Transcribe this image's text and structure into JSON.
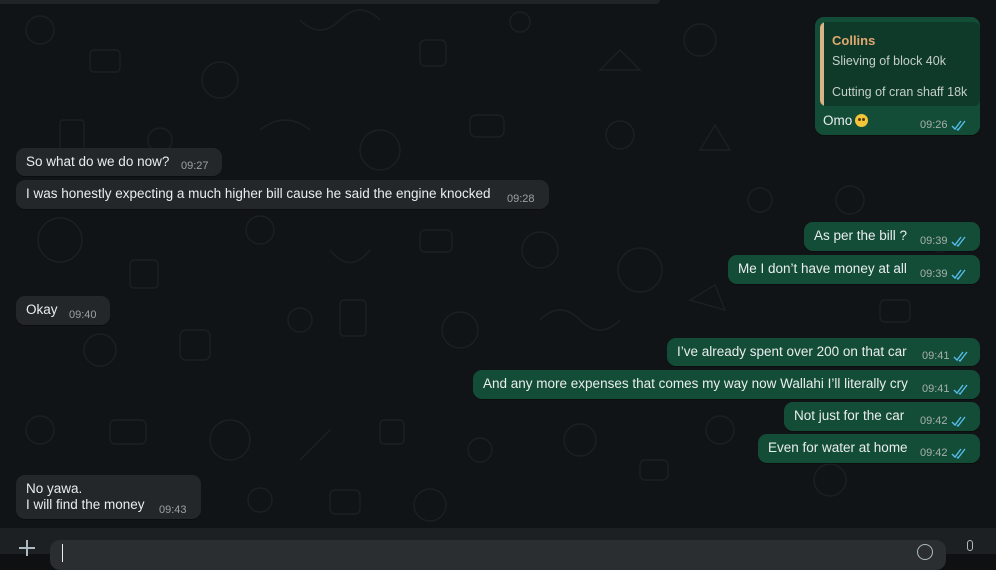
{
  "conversation": {
    "reply_bubble": {
      "quote_author": "Collins",
      "quote_line1": "Slieving of block 40k",
      "quote_line2": "Cutting of cran shaff 18k",
      "text": "Omo",
      "emoji": "pleading-face-emoji",
      "time": "09:26"
    },
    "messages": [
      {
        "direction": "in",
        "text": "So what do we do now?",
        "time": "09:27"
      },
      {
        "direction": "in",
        "text": "I was honestly expecting a much higher bill cause he said the engine knocked",
        "time": "09:28"
      },
      {
        "direction": "out",
        "text": "As per the bill ?",
        "time": "09:39"
      },
      {
        "direction": "out",
        "text": "Me I don’t have money at all",
        "time": "09:39"
      },
      {
        "direction": "in",
        "text": "Okay",
        "time": "09:40"
      },
      {
        "direction": "out",
        "text": "I’ve already spent over 200 on that car",
        "time": "09:41"
      },
      {
        "direction": "out",
        "text": "And any more expenses that comes my way now Wallahi I’ll literally cry",
        "time": "09:41"
      },
      {
        "direction": "out",
        "text": "Not just for the car",
        "time": "09:42"
      },
      {
        "direction": "out",
        "text": "Even for water at home",
        "time": "09:42"
      },
      {
        "direction": "in",
        "text_line1": "No yawa.",
        "text_line2": "I will find the money",
        "time": "09:43"
      }
    ]
  },
  "composer": {
    "attach_icon": "plus-icon",
    "emoji_icon": "emoji-icon",
    "mic_icon": "microphone-icon"
  },
  "colors": {
    "incoming_bubble": "#24272a",
    "outgoing_bubble": "#144d37",
    "read_tick": "#53bdeb",
    "quote_author": "#e0a86f"
  }
}
